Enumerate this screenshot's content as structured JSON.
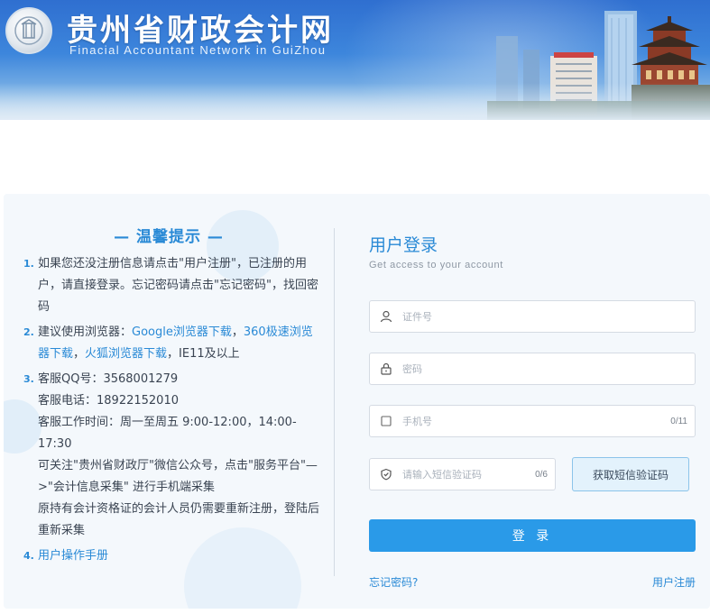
{
  "header": {
    "title": "贵州省财政会计网",
    "subtitle": "Finacial  Accountant Network in GuiZhou"
  },
  "tips": {
    "title": "— 温馨提示 —",
    "item1": {
      "num": "1.",
      "text": "如果您还没注册信息请点击\"用户注册\"，已注册的用户，请直接登录。忘记密码请点击\"忘记密码\"，找回密码"
    },
    "item2": {
      "num": "2.",
      "prefix": "建议使用浏览器：",
      "link_google": "Google浏览器下载",
      "sep1": "，",
      "link_360": "360极速浏览器下载",
      "sep2": "，",
      "link_firefox": "火狐浏览器下载",
      "suffix": "，IE11及以上"
    },
    "item3": {
      "num": "3.",
      "qq": "客服QQ号：3568001279",
      "phone": "客服电话：18922152010",
      "hours": "客服工作时间：周一至周五 9:00-12:00，14:00-17:30",
      "wechat": "可关注\"贵州省财政厅\"微信公众号，点击\"服务平台\"—>\"会计信息采集\" 进行手机端采集",
      "note": "原持有会计资格证的会计人员仍需要重新注册，登陆后重新采集"
    },
    "item4": {
      "num": "4.",
      "link_manual": "用户操作手册"
    }
  },
  "login": {
    "title": "用户登录",
    "subtitle": "Get access to your account",
    "id_placeholder": "证件号",
    "password_placeholder": "密码",
    "phone_placeholder": "手机号",
    "phone_counter": "0/11",
    "sms_placeholder": "请输入短信验证码",
    "sms_counter": "0/6",
    "sms_button": "获取短信验证码",
    "submit": "登 录",
    "forgot": "忘记密码?",
    "register": "用户注册"
  },
  "colors": {
    "accent": "#2a8ad6",
    "primary_button": "#2a9ae8",
    "banner_sky": "#3d86dc"
  }
}
